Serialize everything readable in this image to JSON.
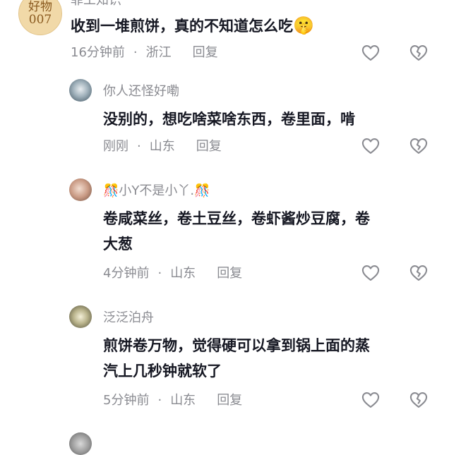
{
  "comments": [
    {
      "username": "菲工知识",
      "avatar_text": "好物",
      "avatar_number": "007",
      "text": "收到一堆煎饼，真的不知道怎么吃",
      "emoji": "🤫",
      "time": "16分钟前",
      "location": "浙江",
      "reply_label": "回复"
    },
    {
      "username": "你人还怪好嘞",
      "text_lines": [
        "没别的，想吃啥菜啥东西，卷里面，啃"
      ],
      "time": "刚刚",
      "location": "山东",
      "reply_label": "回复"
    },
    {
      "username": "小Y不是小丫.",
      "username_decoration": "🎊",
      "text_lines": [
        "卷咸菜丝，卷土豆丝，卷虾酱炒豆腐，卷",
        "大葱"
      ],
      "time": "4分钟前",
      "location": "山东",
      "reply_label": "回复"
    },
    {
      "username": "泛泛泊舟",
      "text_lines": [
        "煎饼卷万物，觉得硬可以拿到锅上面的蒸",
        "汽上几秒钟就软了"
      ],
      "time": "5分钟前",
      "location": "山东",
      "reply_label": "回复"
    }
  ],
  "separator": "·",
  "colors": {
    "meta_text": "#8a8b91",
    "content_text": "#161823",
    "icon_stroke": "#8a8b91",
    "background": "#ffffff"
  }
}
